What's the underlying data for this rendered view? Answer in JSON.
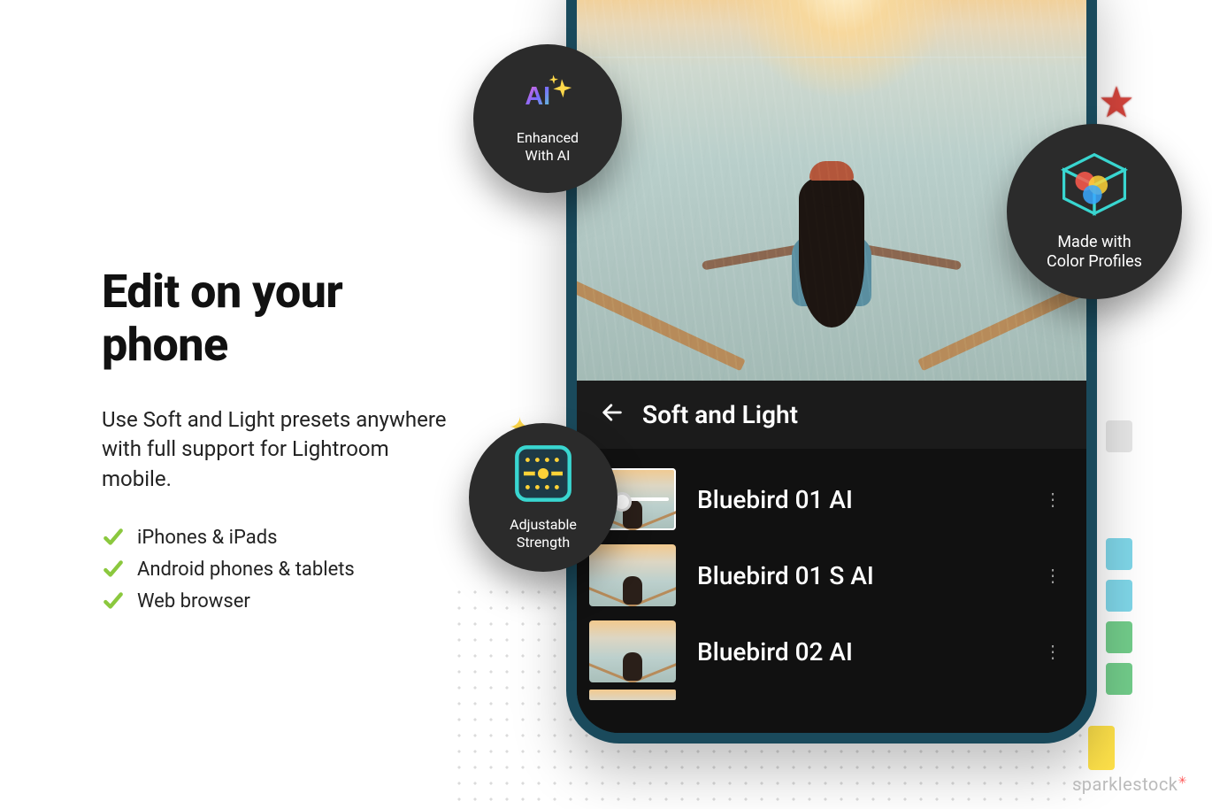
{
  "left": {
    "headline": "Edit on your phone",
    "subtext": "Use Soft and Light presets anywhere with full support for Lightroom mobile.",
    "checks": [
      "iPhones & iPads",
      "Android phones & tablets",
      "Web browser"
    ]
  },
  "phone": {
    "preset_group": "Soft and Light",
    "presets": [
      {
        "name": "Bluebird  01 AI",
        "selected": true
      },
      {
        "name": "Bluebird  01 S AI",
        "selected": false
      },
      {
        "name": "Bluebird  02 AI",
        "selected": false
      }
    ]
  },
  "badges": {
    "ai": {
      "line1": "Enhanced",
      "line2": "With AI"
    },
    "color": {
      "line1": "Made with",
      "line2": "Color Profiles"
    },
    "strength": {
      "line1": "Adjustable",
      "line2": "Strength"
    }
  },
  "watermark": "sparklestock",
  "colors": {
    "check_green": "#8bc83e"
  }
}
